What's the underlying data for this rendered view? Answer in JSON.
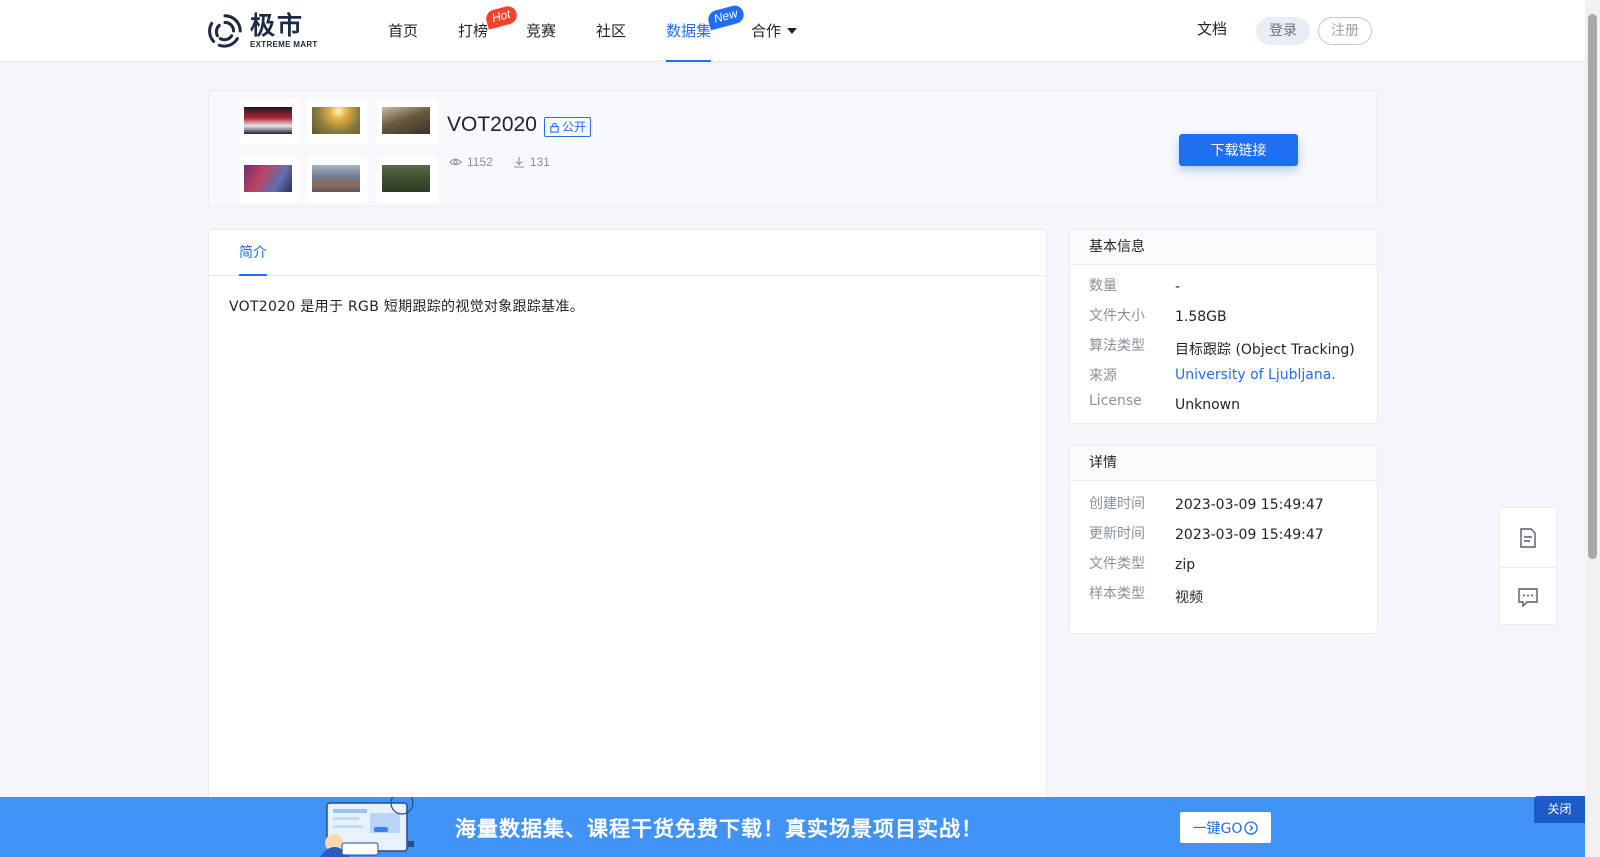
{
  "header": {
    "logo_cn": "极市",
    "logo_en": "EXTREME MART",
    "nav": [
      {
        "label": "首页"
      },
      {
        "label": "打榜",
        "badge": "Hot"
      },
      {
        "label": "竞赛"
      },
      {
        "label": "社区"
      },
      {
        "label": "数据集",
        "badge": "New",
        "active": true
      },
      {
        "label": "合作"
      }
    ],
    "docs": "文档",
    "login": "登录",
    "register": "注册"
  },
  "dataset": {
    "title": "VOT2020",
    "visibility": "公开",
    "views": "1152",
    "downloads": "131",
    "download_button": "下载链接"
  },
  "tabs": {
    "intro": "简介"
  },
  "intro_text": "VOT2020 是用于 RGB 短期跟踪的视觉对象跟踪基准。",
  "basic_info": {
    "title": "基本信息",
    "rows": [
      {
        "key": "数量",
        "value": "-"
      },
      {
        "key": "文件大小",
        "value": "1.58GB"
      },
      {
        "key": "算法类型",
        "value": "目标跟踪 (Object Tracking)"
      },
      {
        "key": "来源",
        "value": "University of Ljubljana."
      },
      {
        "key": "License",
        "value": "Unknown"
      }
    ]
  },
  "details": {
    "title": "详情",
    "rows": [
      {
        "key": "创建时间",
        "value": "2023-03-09 15:49:47"
      },
      {
        "key": "更新时间",
        "value": "2023-03-09 15:49:47"
      },
      {
        "key": "文件类型",
        "value": "zip"
      },
      {
        "key": "样本类型",
        "value": "视频"
      }
    ]
  },
  "banner": {
    "text": "海量数据集、课程干货免费下载！真实场景项目实战！",
    "go_button": "一键GO",
    "close": "关闭"
  },
  "colors": {
    "primary": "#1e6ff1",
    "hot_badge": "#f5422d",
    "banner_bg": "#4193f7"
  },
  "icons": [
    "eye-icon",
    "download-icon",
    "lock-icon",
    "document-icon",
    "chat-icon",
    "arrow-circle-icon",
    "chevron-down-icon"
  ]
}
